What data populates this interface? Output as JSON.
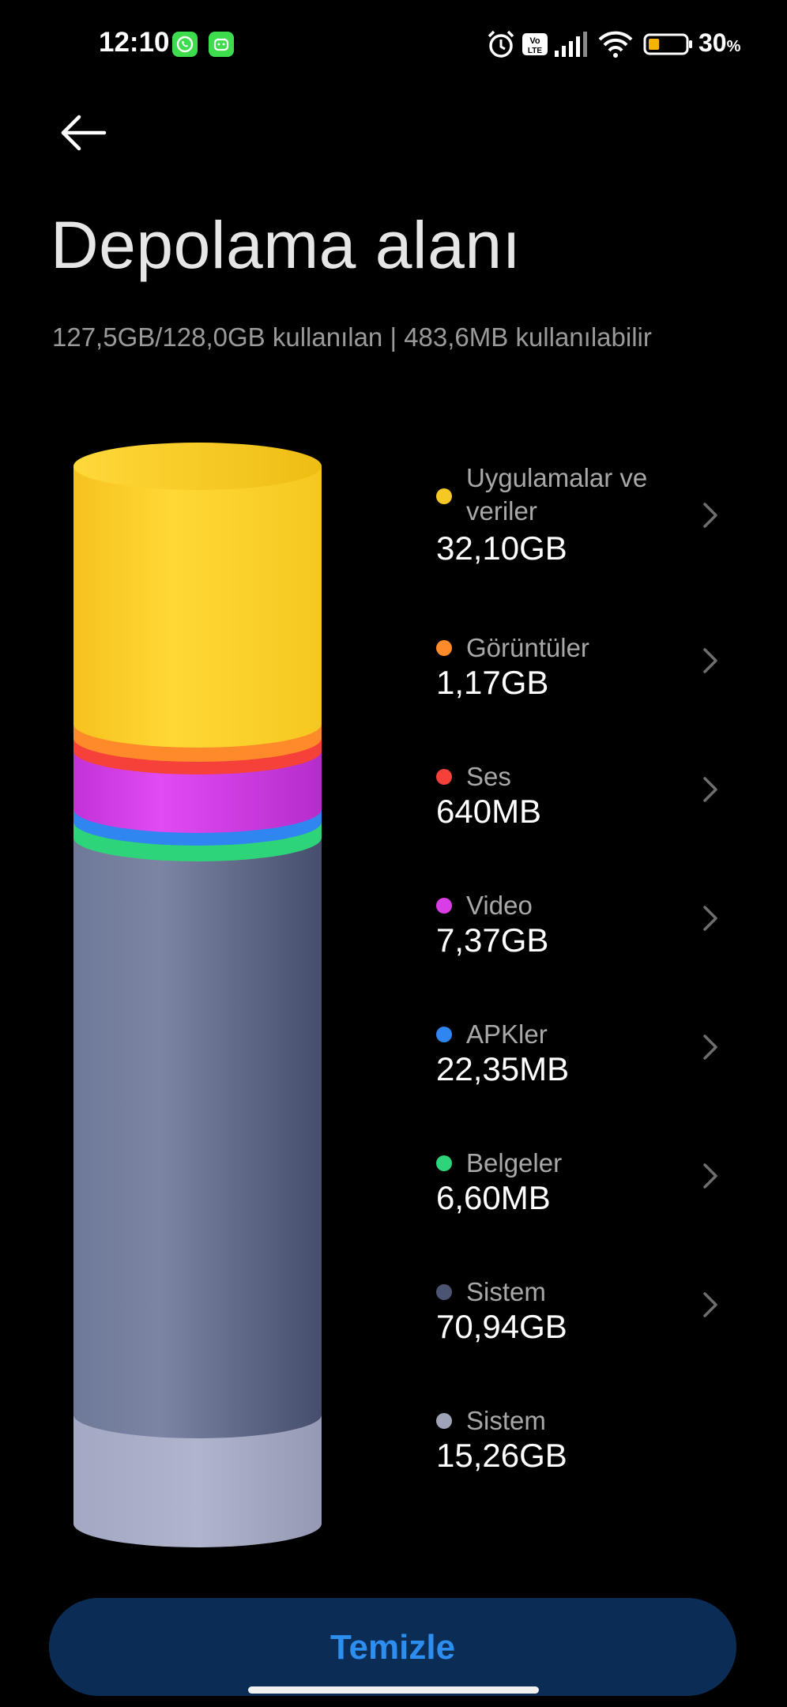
{
  "status_bar": {
    "time": "12:10",
    "battery_percent": "30",
    "battery_unit": "%",
    "battery_level": 0.3,
    "icons": [
      "whatsapp-icon",
      "android-app-icon",
      "alarm-icon",
      "volte-icon",
      "signal-icon",
      "wifi-icon",
      "battery-icon"
    ]
  },
  "header": {
    "back_icon": "arrow-left-icon",
    "title": "Depolama alanı",
    "summary": "127,5GB/128,0GB kullanılan | 483,6MB kullanılabilir"
  },
  "categories": [
    {
      "label": "Uygulamalar ve veriler",
      "value": "32,10GB",
      "color": "#f5c823",
      "has_chevron": true
    },
    {
      "label": "Görüntüler",
      "value": "1,17GB",
      "color": "#ff8a29",
      "has_chevron": true
    },
    {
      "label": "Ses",
      "value": "640MB",
      "color": "#f5413a",
      "has_chevron": true
    },
    {
      "label": "Video",
      "value": "7,37GB",
      "color": "#d93de6",
      "has_chevron": true
    },
    {
      "label": "APKler",
      "value": "22,35MB",
      "color": "#2f86f0",
      "has_chevron": true
    },
    {
      "label": "Belgeler",
      "value": "6,60MB",
      "color": "#2ed47a",
      "has_chevron": true
    },
    {
      "label": "Sistem",
      "value": "70,94GB",
      "color": "#4b5470",
      "has_chevron": true
    },
    {
      "label": "Sistem",
      "value": "15,26GB",
      "color": "#9ea3b8",
      "has_chevron": false
    }
  ],
  "clean_button": {
    "label": "Temizle"
  },
  "colors": {
    "background": "#000000",
    "button_bg": "#0b2d55",
    "button_text": "#2d8ef0"
  }
}
